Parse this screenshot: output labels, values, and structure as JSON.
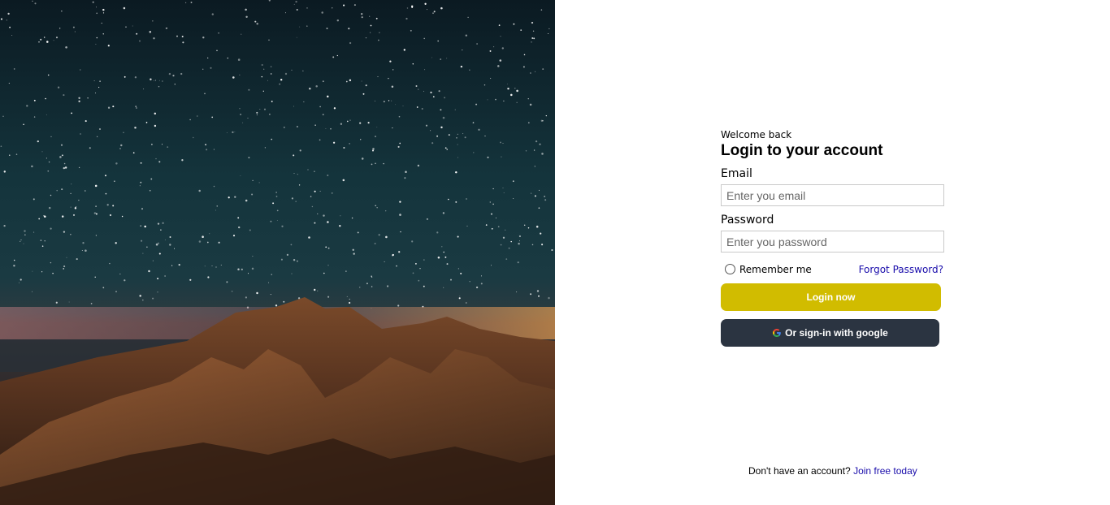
{
  "hero": {
    "image": "starry-night-mountain"
  },
  "form": {
    "welcome": "Welcome back",
    "title": "Login to your account",
    "email_label": "Email",
    "email_placeholder": "Enter you email",
    "password_label": "Password",
    "password_placeholder": "Enter you password",
    "remember_label": "Remember me",
    "forgot_label": "Forgot Password?",
    "login_label": "Login now",
    "google_label": "Or sign-in with google"
  },
  "footer": {
    "prompt": "Don't have an account?",
    "join_label": "Join free today"
  },
  "colors": {
    "login_button": "#d1bc00",
    "google_button": "#2b3441",
    "link": "#1a0dab"
  }
}
